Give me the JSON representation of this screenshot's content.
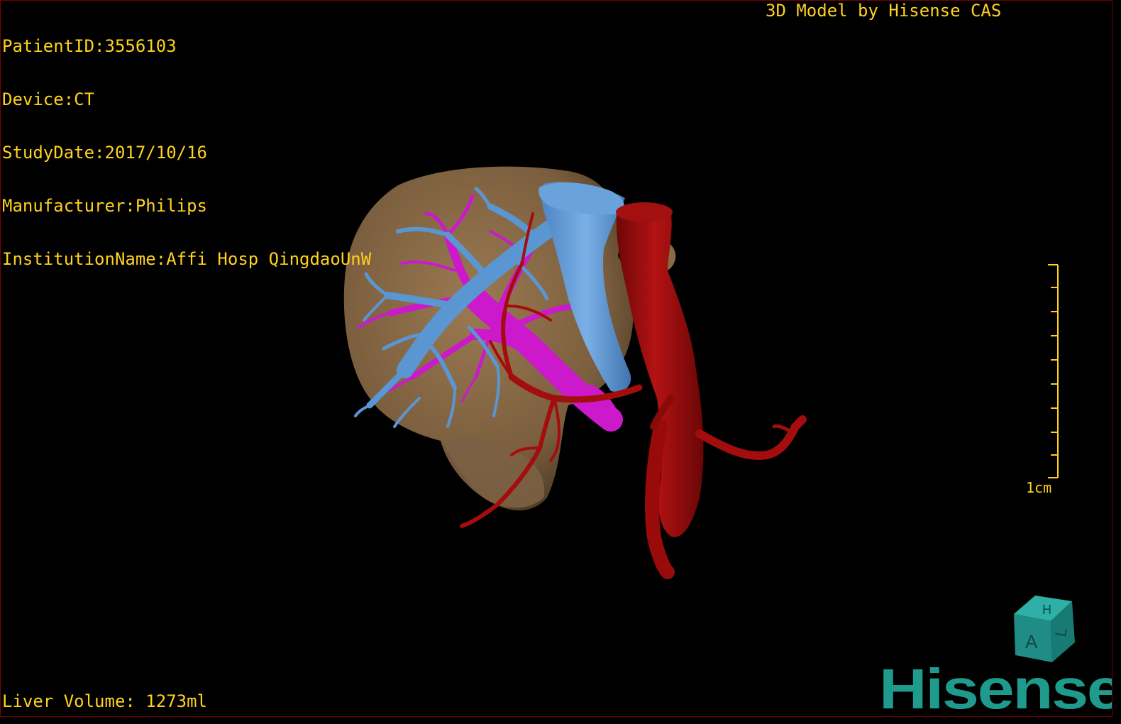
{
  "patient_info": {
    "patient_id": "PatientID:3556103",
    "device": "Device:CT",
    "study_date": "StudyDate:2017/10/16",
    "manufacturer": "Manufacturer:Philips",
    "institution": "InstitutionName:Affi Hosp QingdaoUnW"
  },
  "brand_caption": "3D Model by Hisense CAS",
  "liver_volume": "Liver Volume: 1273ml",
  "scale_bar": {
    "label": "1cm"
  },
  "orientation_cube": {
    "labels": [
      "H",
      "A",
      "L"
    ],
    "icon": "orientation-cube-icon"
  },
  "logo": {
    "text": "Hisense",
    "color": "#1f9b8e"
  },
  "colors": {
    "hud_text": "#ffd21e",
    "liver": "#8a6a45",
    "hepatic_vein": "#5a96d2",
    "portal_vein": "#cc19cc",
    "artery": "#a30d0d",
    "background": "#000000"
  }
}
